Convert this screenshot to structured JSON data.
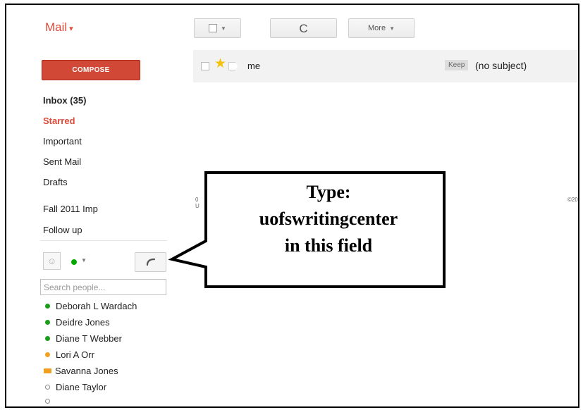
{
  "header": {
    "app_label": "Mail",
    "app_caret": "▾",
    "refresh_glyph": "C",
    "more_label": "More"
  },
  "compose_label": "COMPOSE",
  "message": {
    "sender": "me",
    "tag": "Keep",
    "subject": "(no subject)"
  },
  "nav": [
    {
      "label": "Inbox (35)"
    },
    {
      "label": "Starred"
    },
    {
      "label": "Important"
    },
    {
      "label": "Sent Mail"
    },
    {
      "label": "Drafts"
    },
    {
      "label": "Fall 2011 Imp"
    },
    {
      "label": "Follow up"
    }
  ],
  "footer": {
    "left_line1": "0",
    "left_line2": "U",
    "right": "©201"
  },
  "chat": {
    "search_placeholder": "Search people...",
    "contacts": [
      {
        "name": "Deborah L Wardach",
        "status": "available"
      },
      {
        "name": "Deidre Jones",
        "status": "available"
      },
      {
        "name": "Diane T Webber",
        "status": "available"
      },
      {
        "name": "Lori A Orr",
        "status": "idle"
      },
      {
        "name": "Savanna Jones",
        "status": "video"
      },
      {
        "name": "Diane Taylor",
        "status": "offline"
      }
    ]
  },
  "callout": {
    "line1": "Type:",
    "line2": "uofswritingcenter",
    "line3": "in this field"
  },
  "colors": {
    "accent_red": "#dd4b39",
    "compose_red": "#d14836",
    "available_green": "#1a9e1a",
    "idle_orange": "#f0a020",
    "star_yellow": "#f4c20d"
  },
  "icons": {
    "select_checkbox": "checkbox-icon",
    "refresh": "refresh-icon",
    "star": "star-icon",
    "label": "label-icon",
    "avatar": "person-icon",
    "phone": "phone-icon"
  }
}
